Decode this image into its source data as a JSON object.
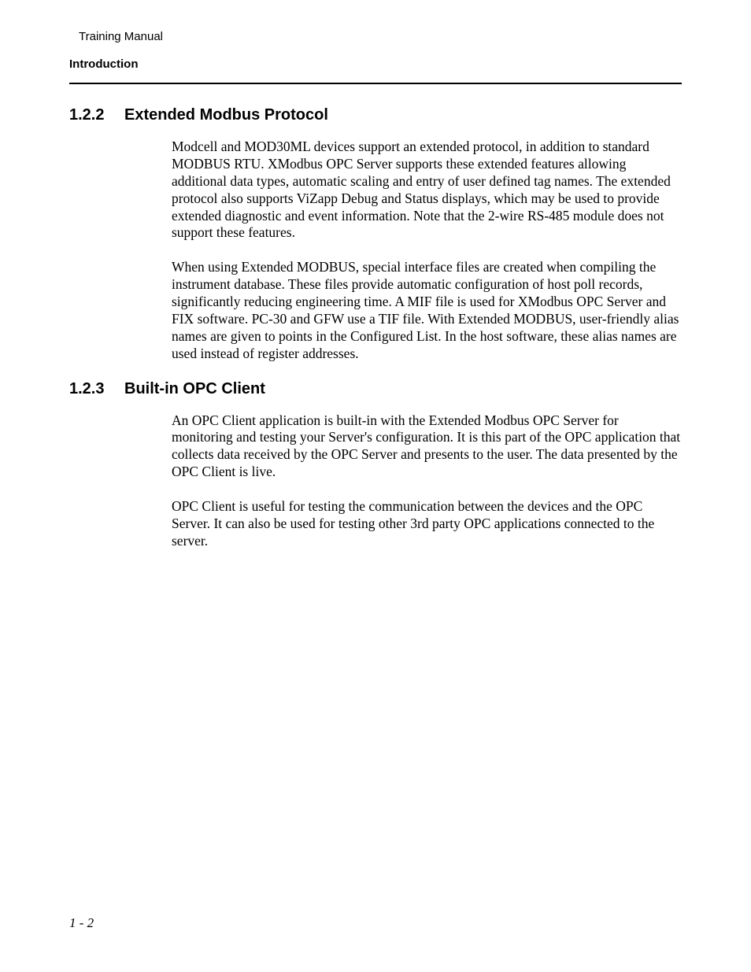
{
  "header": {
    "doc_title": "Training Manual",
    "chapter_title": "Introduction"
  },
  "sections": {
    "s1": {
      "number": "1.2.2",
      "title": "Extended Modbus Protocol",
      "p1": "Modcell and MOD30ML devices support an extended protocol, in addition to standard MODBUS RTU.  XModbus OPC Server supports these extended features allowing additional data types, automatic scaling and entry of user defined tag names. The extended protocol also supports ViZapp Debug and Status displays, which may be used to provide extended diagnostic and event information.  Note that the 2-wire RS-485 module does not support these features.",
      "p2": "When using Extended MODBUS, special interface files are created when compiling the instrument database.  These files provide automatic configuration of host poll records, significantly reducing engineering time.  A MIF file is used for XModbus OPC Server and FIX software.  PC-30 and GFW use a TIF file.  With Extended MODBUS, user-friendly alias names are given to points in the Configured List.  In the host software, these alias names are used instead of register addresses."
    },
    "s2": {
      "number": "1.2.3",
      "title": "Built-in OPC Client",
      "p1": "An OPC Client application is built-in with the Extended Modbus OPC Server for monitoring and testing your Server's configuration. It is this part of the OPC application that collects data received by the OPC Server and presents to the user. The data presented by the OPC Client is live.",
      "p2": "OPC Client is useful for testing the communication between the devices and the OPC Server. It can also be used for testing other 3rd party OPC applications connected to the server."
    }
  },
  "footer": {
    "page_number": "1 - 2"
  }
}
